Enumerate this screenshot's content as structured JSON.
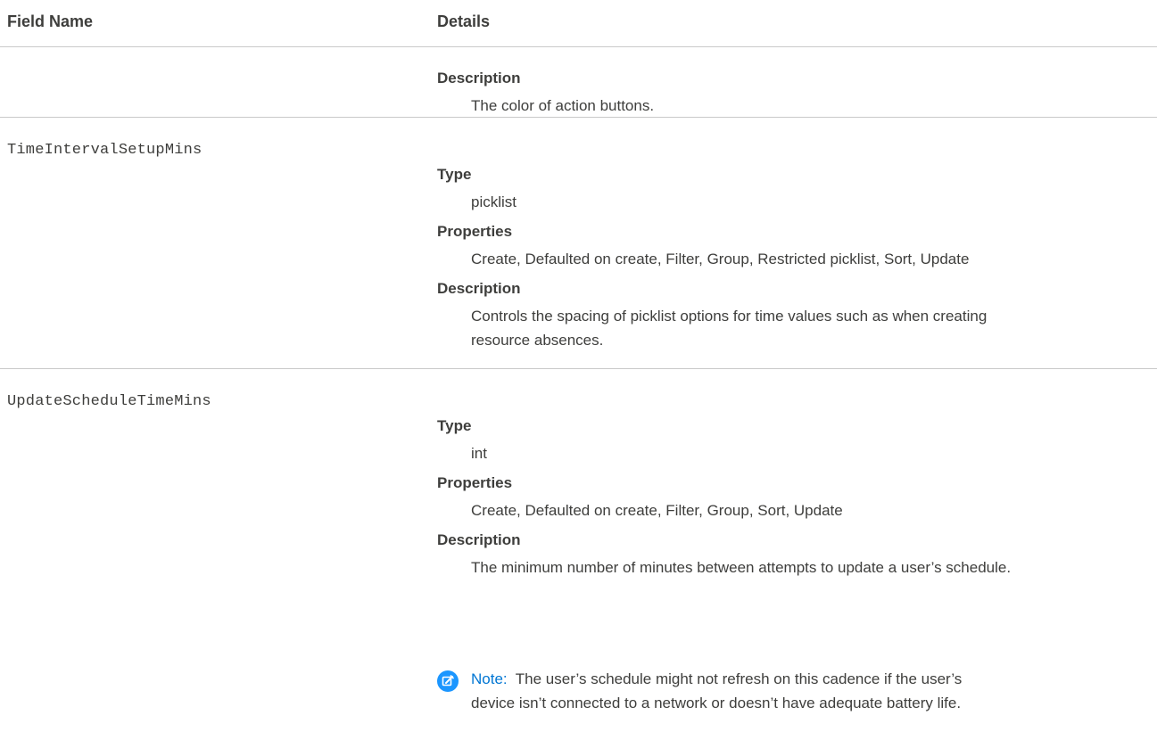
{
  "header": {
    "field_name_label": "Field Name",
    "details_label": "Details"
  },
  "rows": [
    {
      "field": "",
      "description_label": "Description",
      "description": "The color of action buttons."
    },
    {
      "field": "TimeIntervalSetupMins",
      "type_label": "Type",
      "type": "picklist",
      "properties_label": "Properties",
      "properties": "Create, Defaulted on create, Filter, Group, Restricted picklist, Sort, Update",
      "description_label": "Description",
      "description_line1": "Controls the spacing of picklist options for time values such as when creating",
      "description_line2": "resource absences."
    },
    {
      "field": "UpdateScheduleTimeMins",
      "type_label": "Type",
      "type": "int",
      "properties_label": "Properties",
      "properties": "Create, Defaulted on create, Filter, Group, Sort, Update",
      "description_label": "Description",
      "description": "The minimum number of minutes between attempts to update a user’s schedule.",
      "note": {
        "icon": "edit-note-icon",
        "label": "Note:",
        "line1": "The user’s schedule might not refresh on this cadence if the user’s",
        "line2": "device isn’t connected to a network or doesn’t have adequate battery life."
      }
    }
  ],
  "colors": {
    "text": "#3e3e3c",
    "divider": "#c9c9c9",
    "note_icon": "#1b96ff",
    "note_label": "#0176d3"
  }
}
